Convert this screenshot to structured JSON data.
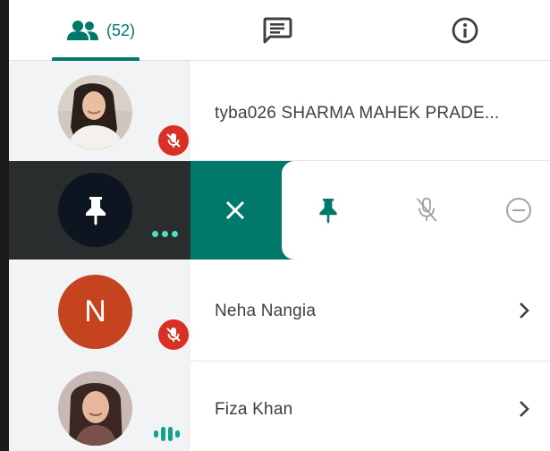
{
  "tabs": {
    "people_count": "(52)",
    "accent_color": "#00796b"
  },
  "participants": [
    {
      "name": "tyba026 SHARMA MAHEK PRADE...",
      "muted": true,
      "avatar": "photo"
    },
    {
      "avatar": "pin-icon",
      "state": "expanded-actions"
    },
    {
      "name": "Neha Nangia",
      "avatar_letter": "N",
      "muted": true
    },
    {
      "name": "Fiza Khan",
      "speaking": true,
      "avatar": "photo"
    }
  ],
  "actions": {
    "close_icon": "close-icon",
    "pin_icon": "pin-icon",
    "mute_icon": "mic-off-icon",
    "remove_icon": "remove-icon"
  },
  "colors": {
    "mute_badge": "#d93025",
    "letter_avatar": "#c5431f",
    "speaking": "#12a18f"
  }
}
